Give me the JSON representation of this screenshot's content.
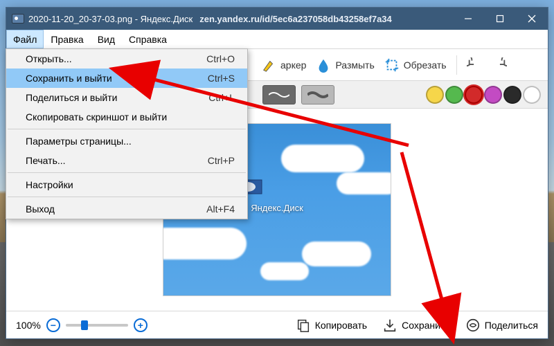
{
  "titlebar": {
    "title": "2020-11-20_20-37-03.png - Яндекс.Диск",
    "url": "zen.yandex.ru/id/5ec6a237058db43258ef7a34"
  },
  "menubar": {
    "items": [
      "Файл",
      "Правка",
      "Вид",
      "Справка"
    ]
  },
  "toolbar": {
    "marker": "аркер",
    "blur": "Размыть",
    "crop": "Обрезать"
  },
  "palette": {
    "colors": [
      "#f6d64a",
      "#55b94e",
      "#d22a2a",
      "#c34bc3",
      "#2a2a2a",
      "#ffffff"
    ]
  },
  "canvas": {
    "label": "Яндекс.Диск"
  },
  "statusbar": {
    "zoom": "100%",
    "copy": "Копировать",
    "save": "Сохранить",
    "share": "Поделиться"
  },
  "dropdown": {
    "items": [
      {
        "label": "Открыть...",
        "shortcut": "Ctrl+O"
      },
      {
        "label": "Сохранить и выйти",
        "shortcut": "Ctrl+S",
        "highlight": true
      },
      {
        "label": "Поделиться и выйти",
        "shortcut": "Ctrl+L"
      },
      {
        "label": "Скопировать скриншот и выйти",
        "shortcut": ""
      },
      {
        "sep": true
      },
      {
        "label": "Параметры страницы...",
        "shortcut": ""
      },
      {
        "label": "Печать...",
        "shortcut": "Ctrl+P"
      },
      {
        "sep": true
      },
      {
        "label": "Настройки",
        "shortcut": ""
      },
      {
        "sep": true
      },
      {
        "label": "Выход",
        "shortcut": "Alt+F4"
      }
    ]
  }
}
